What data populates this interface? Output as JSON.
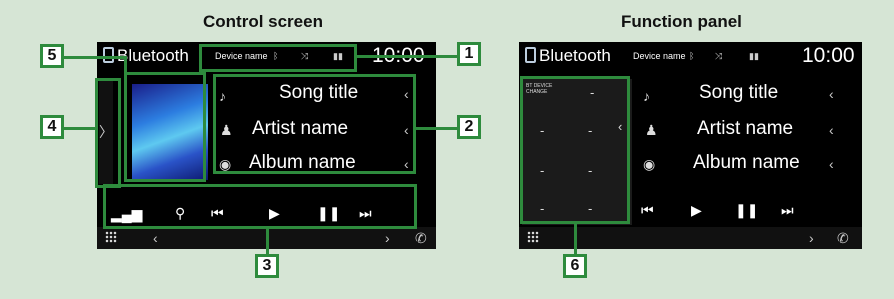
{
  "headings": {
    "control": "Control screen",
    "function": "Function panel"
  },
  "control": {
    "source": "Bluetooth",
    "device": "Device name",
    "clock": "10:00",
    "song": "Song title",
    "artist": "Artist name",
    "album": "Album name"
  },
  "function_panel": {
    "source": "Bluetooth",
    "device": "Device name",
    "clock": "10:00",
    "song": "Song title",
    "artist": "Artist name",
    "album": "Album name",
    "panel_label": "BT DEVICE CHANGE"
  },
  "callouts": [
    "1",
    "2",
    "3",
    "4",
    "5",
    "6"
  ],
  "colors": {
    "callout": "#2e8b3d",
    "background": "#d6e5d5",
    "screen": "#000000"
  }
}
